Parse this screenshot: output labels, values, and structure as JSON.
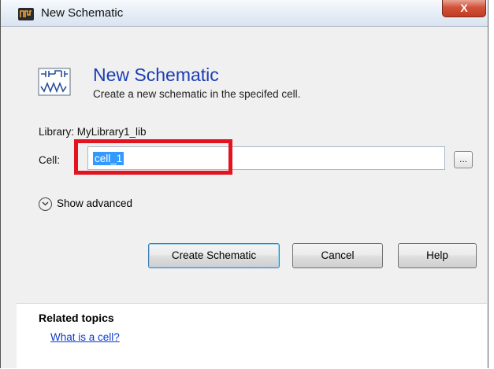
{
  "window": {
    "title": "New Schematic",
    "close_glyph": "X"
  },
  "header": {
    "title": "New Schematic",
    "subtitle": "Create a new schematic in the specifed cell.",
    "icon": "schematic-icon"
  },
  "form": {
    "library_text": "Library: MyLibrary1_lib",
    "cell_label": "Cell:",
    "cell_value": "cell_1",
    "browse_label": "..."
  },
  "advanced": {
    "label": "Show advanced"
  },
  "buttons": {
    "create": "Create Schematic",
    "cancel": "Cancel",
    "help": "Help"
  },
  "related": {
    "title": "Related topics",
    "link": "What is a cell?"
  },
  "colors": {
    "accent_title": "#1a3db3",
    "highlight": "#e1141f",
    "selection": "#3399ff",
    "link": "#0c3bcf"
  }
}
